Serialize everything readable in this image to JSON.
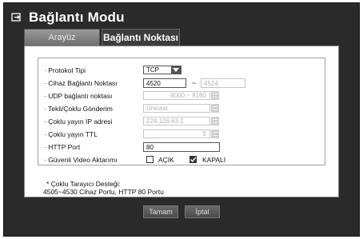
{
  "window": {
    "title": "Bağlantı Modu",
    "icon": "network-icon"
  },
  "tabs": [
    {
      "label": "Arayüz",
      "active": false
    },
    {
      "label": "Bağlantı Noktası",
      "active": true
    }
  ],
  "form": {
    "protocol": {
      "label": "· Protokol Tipi",
      "value": "TCP"
    },
    "device_port": {
      "label": "· Cihaz Bağlantı Noktası",
      "from": "4520",
      "separator": "~",
      "to": "4524"
    },
    "udp_port": {
      "label": "· UDP bağlantı noktası",
      "value": "8000 ~ 8160"
    },
    "uni_multi": {
      "label": "· Tekli/Çoklu Gönderim",
      "value": "Unicast"
    },
    "multicast_ip": {
      "label": "· Çoklu yayın IP adresi",
      "value": "224.126.63.1"
    },
    "multicast_ttl": {
      "label": "· Çoklu yayın TTL",
      "value": "5"
    },
    "http_port": {
      "label": "· HTTP Port",
      "value": "80"
    },
    "secure_video": {
      "label": "· Güvenli Video Aktarımı",
      "on_label": "AÇIK",
      "off_label": "KAPALI",
      "on_checked": false,
      "off_checked": true
    }
  },
  "notes": {
    "line1": "* Çoklu Tarayıcı Desteği:",
    "line2": "4505~4530 Cihaz Portu, HTTP 80 Portu"
  },
  "buttons": {
    "ok": "Tamam",
    "cancel": "İptal"
  }
}
